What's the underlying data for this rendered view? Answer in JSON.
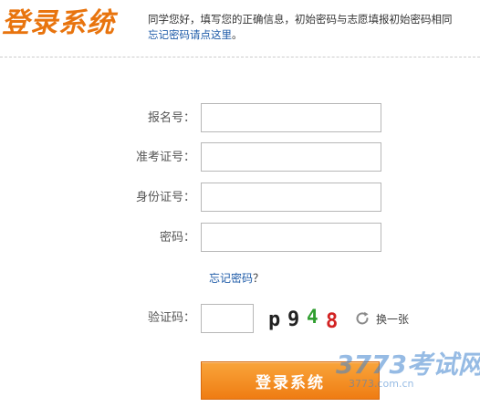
{
  "header": {
    "title": "登录系统",
    "notice_line1": "同学您好，填写您的正确信息，初始密码与志愿填报初始密码相同",
    "notice_link": "忘记密码请点这里",
    "notice_end": "。"
  },
  "form": {
    "fields": [
      {
        "label": "报名号：",
        "value": ""
      },
      {
        "label": "准考证号：",
        "value": ""
      },
      {
        "label": "身份证号：",
        "value": ""
      },
      {
        "label": "密码：",
        "value": ""
      }
    ],
    "forgot_link": "忘记密码",
    "forgot_suffix": "？",
    "captcha": {
      "label": "验证码：",
      "value": "",
      "chars": [
        "p",
        "9",
        "4",
        "8"
      ],
      "char_colors": [
        "#222222",
        "#222222",
        "#2f9e2f",
        "#d22222"
      ],
      "refresh_label": "换一张"
    },
    "submit_label": "登录系统"
  },
  "watermark": {
    "main": "3773考试网",
    "sub": "3773.com.cn"
  },
  "colors": {
    "accent": "#ef7c13",
    "link": "#1e5ba8",
    "watermark": "#4084ce"
  }
}
